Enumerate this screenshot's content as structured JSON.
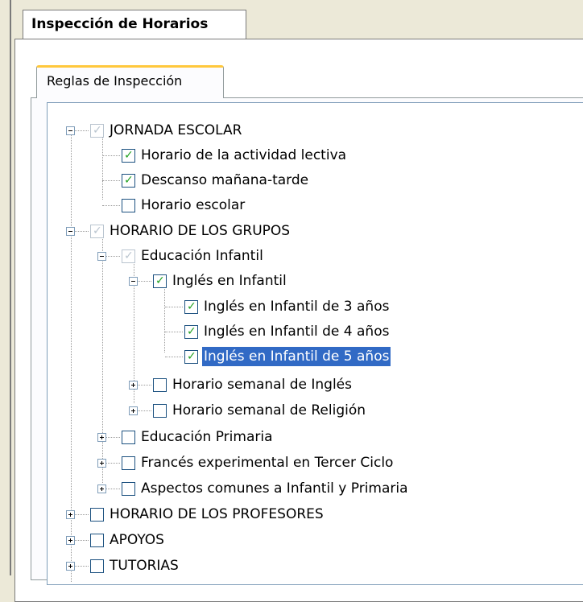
{
  "window_tab": {
    "title": "Inspección de Horarios"
  },
  "inner_tab": {
    "label": "Reglas de Inspección"
  },
  "colors": {
    "selection": "#316ac5",
    "check": "#21a121",
    "tab_accent": "#ffc83c"
  },
  "tree": {
    "items": [
      {
        "label": "JORNADA ESCOLAR",
        "checked": "partial",
        "expander": "minus"
      },
      {
        "label": "Horario de la actividad lectiva",
        "checked": true
      },
      {
        "label": "Descanso mañana-tarde",
        "checked": true
      },
      {
        "label": "Horario escolar",
        "checked": false
      },
      {
        "label": "HORARIO DE LOS GRUPOS",
        "checked": "partial",
        "expander": "minus"
      },
      {
        "label": "Educación Infantil",
        "checked": "partial",
        "expander": "minus"
      },
      {
        "label": "Inglés en Infantil",
        "checked": true,
        "expander": "minus"
      },
      {
        "label": "Inglés en Infantil de 3 años",
        "checked": true
      },
      {
        "label": "Inglés en Infantil de 4 años",
        "checked": true
      },
      {
        "label": "Inglés en Infantil de 5 años",
        "checked": true,
        "selected": true
      },
      {
        "label": "Horario semanal de Inglés",
        "checked": false,
        "expander": "plus"
      },
      {
        "label": "Horario semanal de Religión",
        "checked": false,
        "expander": "plus"
      },
      {
        "label": "Educación Primaria",
        "checked": false,
        "expander": "plus"
      },
      {
        "label": "Francés experimental en Tercer Ciclo",
        "checked": false,
        "expander": "plus"
      },
      {
        "label": "Aspectos comunes a Infantil y Primaria",
        "checked": false,
        "expander": "plus"
      },
      {
        "label": "HORARIO DE LOS PROFESORES",
        "checked": false,
        "expander": "plus"
      },
      {
        "label": "APOYOS",
        "checked": false,
        "expander": "plus"
      },
      {
        "label": "TUTORIAS",
        "checked": false,
        "expander": "plus"
      }
    ]
  }
}
